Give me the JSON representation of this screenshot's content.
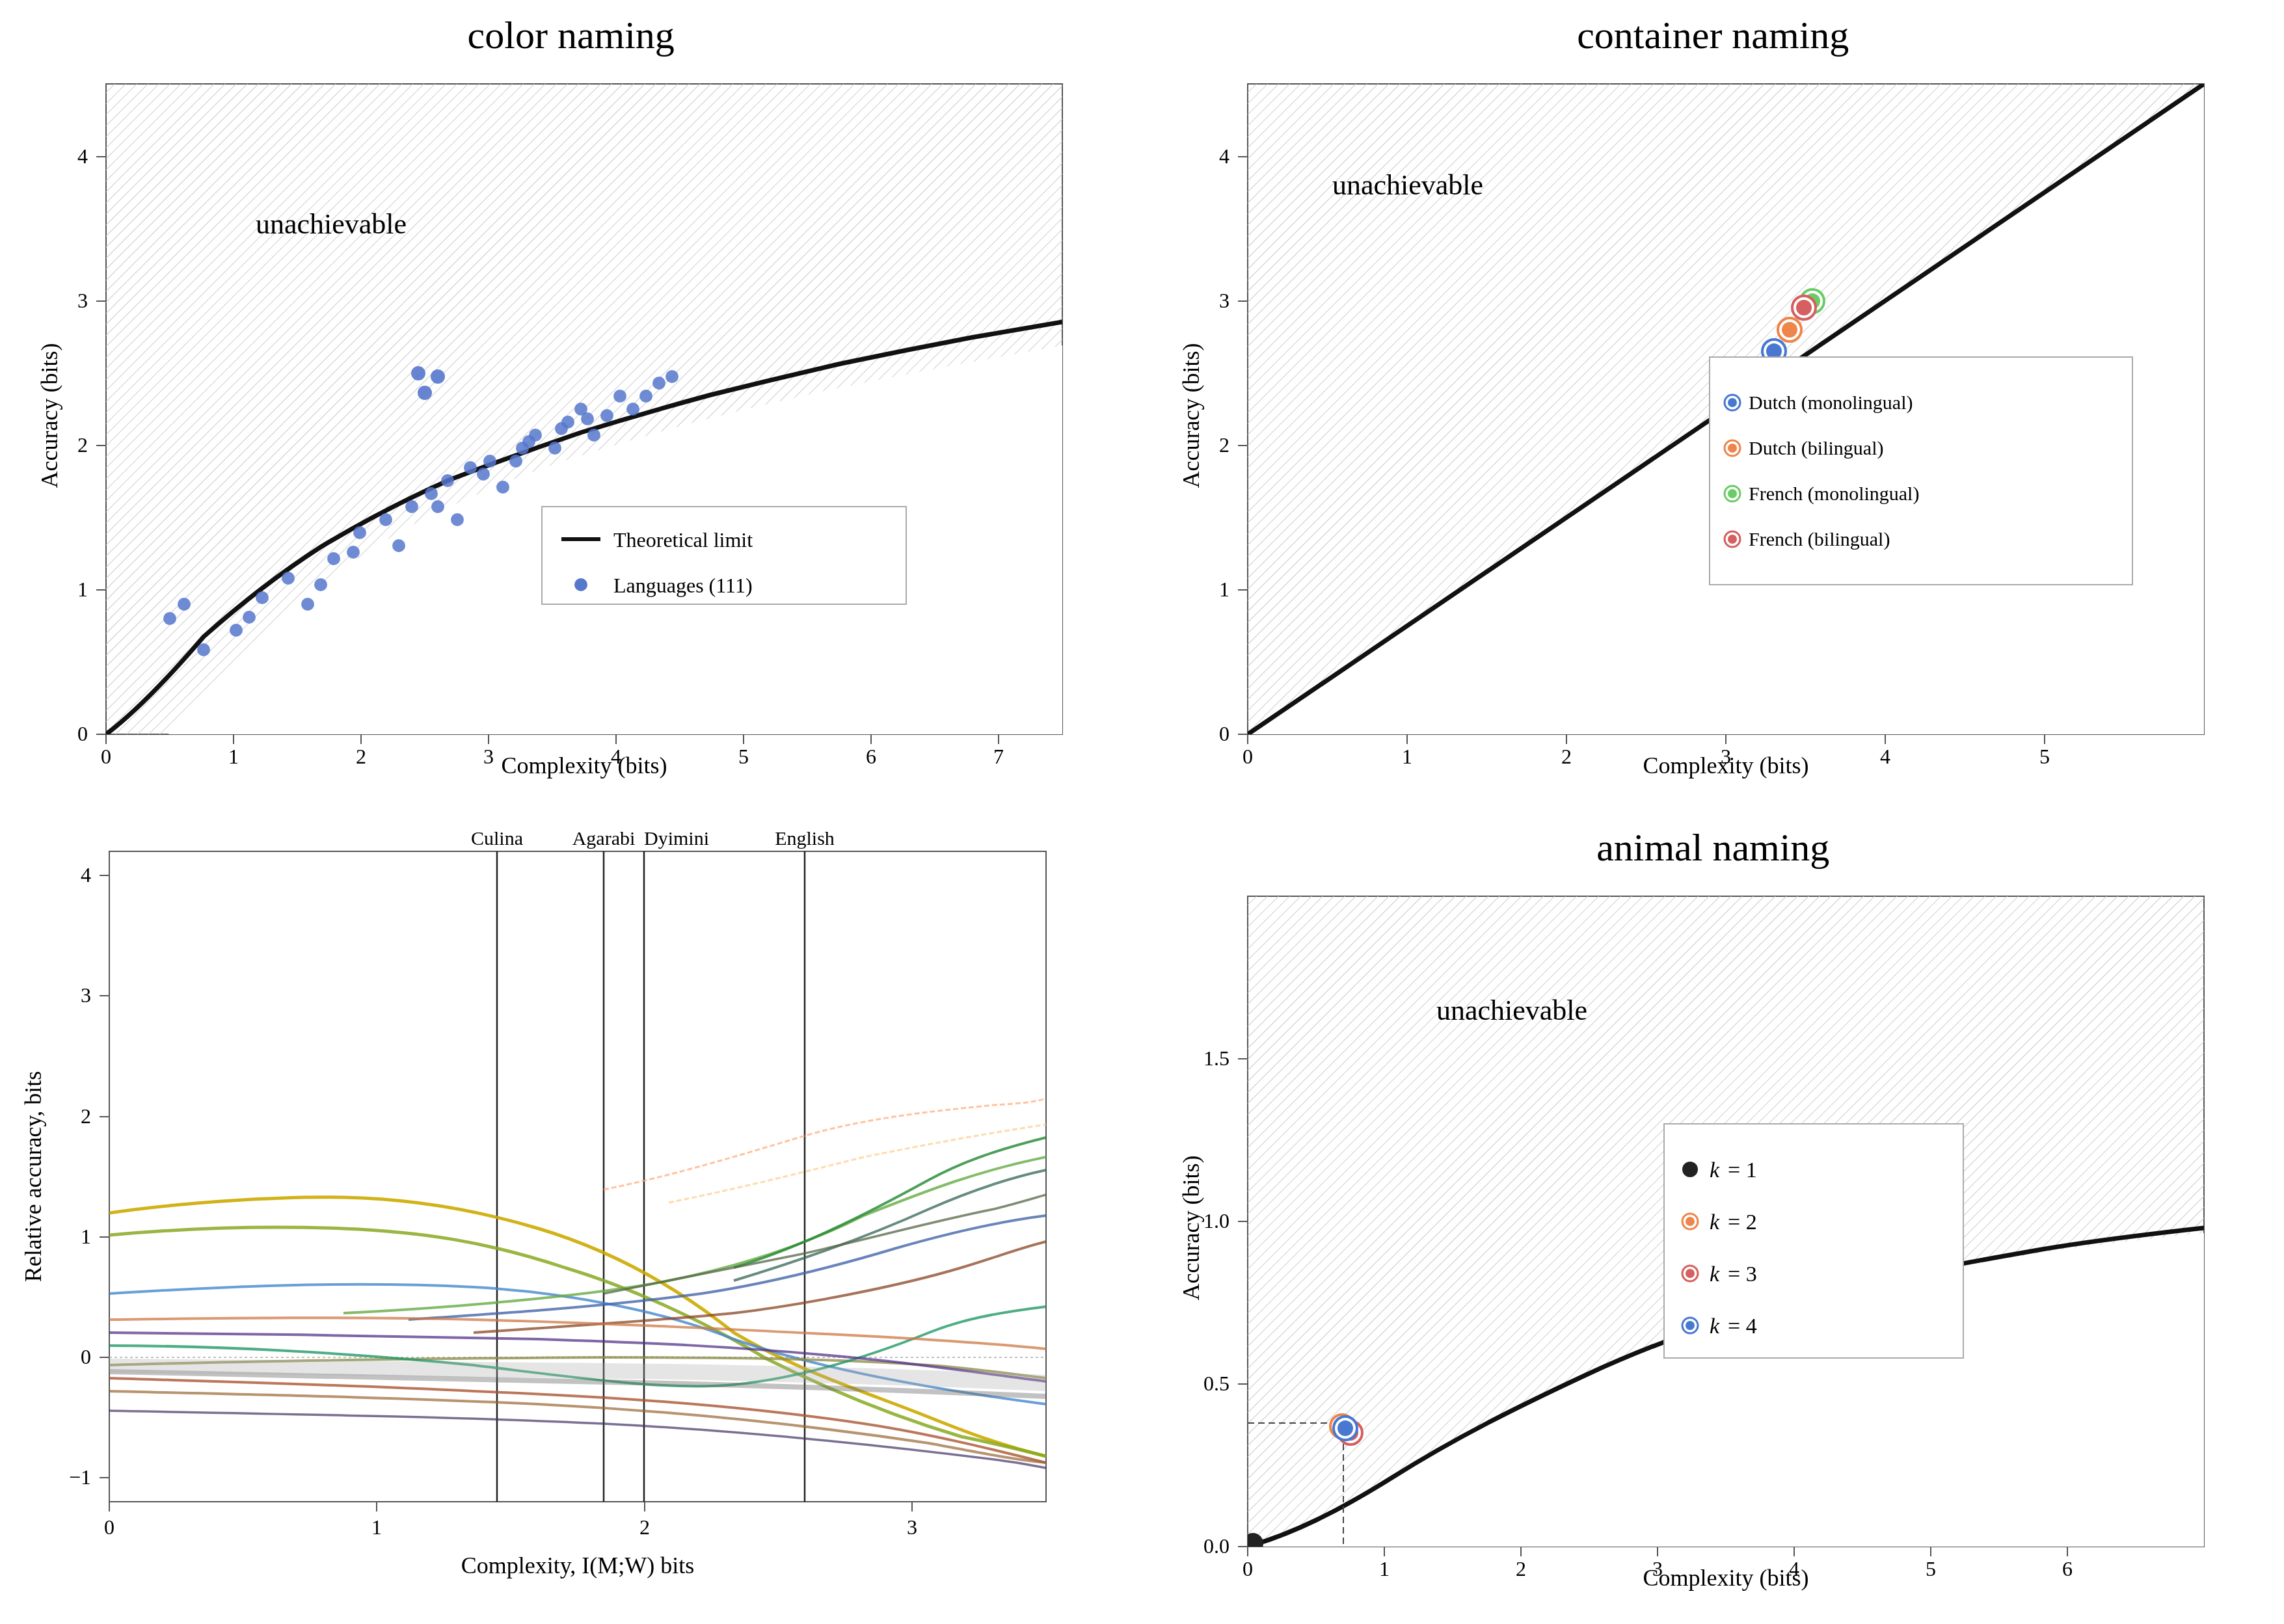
{
  "panels": {
    "color_naming": {
      "title": "color naming",
      "x_label": "Complexity (bits)",
      "y_label": "Accuracy (bits)",
      "unachievable": "unachievable",
      "legend": {
        "line": "Theoretical limit",
        "dots": "Languages (111)"
      },
      "x_max": 7.5,
      "y_max": 4.5
    },
    "container_naming": {
      "title": "container naming",
      "x_label": "Complexity (bits)",
      "y_label": "Accuracy (bits)",
      "unachievable": "unachievable",
      "legend": [
        {
          "label": "Dutch (monolingual)",
          "color": "#4878d0"
        },
        {
          "label": "Dutch (bilingual)",
          "color": "#ee854a"
        },
        {
          "label": "French (monolingual)",
          "color": "#6acc65"
        },
        {
          "label": "French (bilingual)",
          "color": "#d65f5f"
        }
      ],
      "x_max": 6,
      "y_max": 4.5
    },
    "relative_accuracy": {
      "x_label": "Complexity, I(M;W) bits",
      "y_label": "Relative accuracy, bits",
      "annotations": [
        "Culina",
        "Agarabi",
        "Dyimini",
        "English"
      ],
      "x_max": 3.5,
      "y_min": -1.2,
      "y_max": 4.2
    },
    "animal_naming": {
      "title": "animal naming",
      "x_label": "Complexity (bits)",
      "y_label": "Accuracy (bits)",
      "unachievable": "unachievable",
      "legend": [
        {
          "label": "k = 1",
          "color": "#222222"
        },
        {
          "label": "k = 2",
          "color": "#ee854a"
        },
        {
          "label": "k = 3",
          "color": "#d65f5f"
        },
        {
          "label": "k = 4",
          "color": "#4878d0"
        }
      ],
      "x_max": 7,
      "y_max": 2.0
    }
  }
}
